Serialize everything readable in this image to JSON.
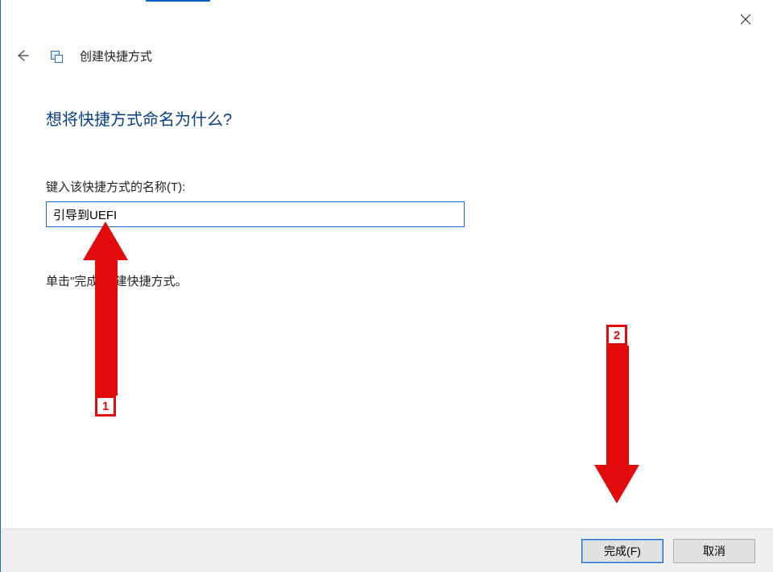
{
  "window": {
    "close_icon": "close-icon"
  },
  "header": {
    "back_icon": "back-arrow-icon",
    "wizard_title": "创建快捷方式"
  },
  "content": {
    "headline": "想将快捷方式命名为什么?",
    "name_label": "键入该快捷方式的名称(T):",
    "name_value": "引导到UEFI",
    "hint": "单击\"完成\"创建快捷方式。"
  },
  "buttons": {
    "finish": "完成(F)",
    "cancel": "取消"
  },
  "annotations": {
    "one": "1",
    "two": "2",
    "color": "#e20a0a"
  }
}
